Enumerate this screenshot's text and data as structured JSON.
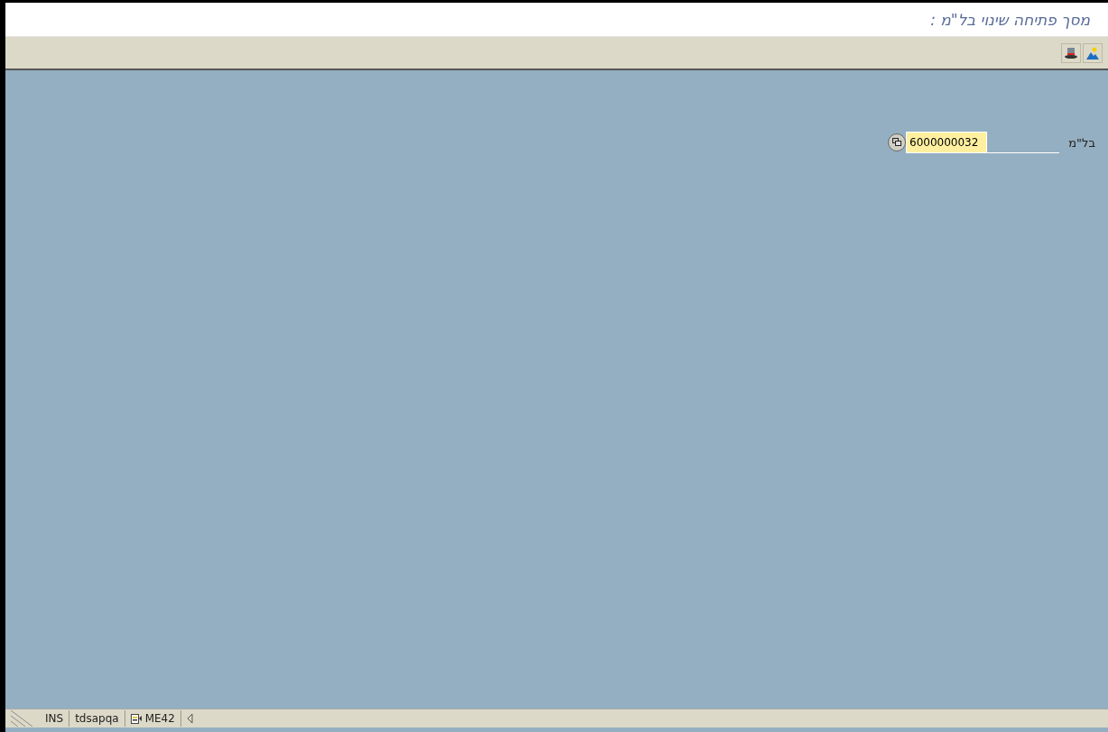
{
  "window": {
    "title": "מסך פתיחה שינוי בל\"מ :"
  },
  "toolbar": {
    "buttons": [
      {
        "kind": "hat"
      },
      {
        "kind": "picture"
      }
    ]
  },
  "form": {
    "fields": [
      {
        "label": "בל\"מ",
        "value": "6000000032"
      }
    ]
  },
  "status_bar": {
    "mode": "INS",
    "server": "tdsapqa",
    "transaction": "ME42"
  }
}
